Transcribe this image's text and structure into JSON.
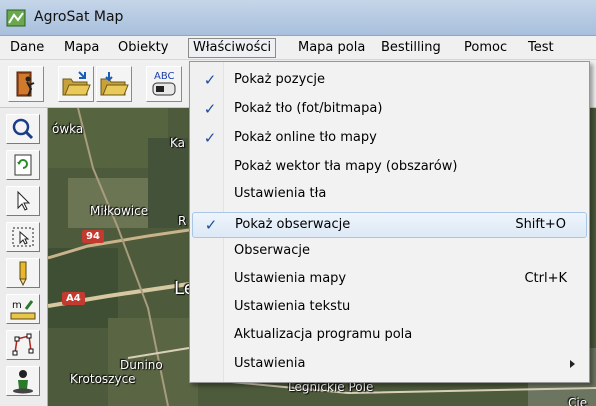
{
  "window": {
    "title": "AgroSat Map"
  },
  "menubar": {
    "items": [
      {
        "label": "Dane"
      },
      {
        "label": "Mapa"
      },
      {
        "label": "Obiekty"
      },
      {
        "label": "Właściwości"
      },
      {
        "label": "Mapa pola"
      },
      {
        "label": "Bestilling"
      },
      {
        "label": "Pomoc"
      },
      {
        "label": "Test"
      }
    ]
  },
  "toolbar": {
    "buttons": [
      {
        "icon": "exit-door-icon"
      },
      {
        "icon": "open-folder-icon"
      },
      {
        "icon": "save-folder-icon"
      },
      {
        "icon": "text-abc-icon",
        "label": "ABC"
      }
    ]
  },
  "side_toolbar": {
    "buttons": [
      {
        "icon": "zoom-icon"
      },
      {
        "icon": "refresh-icon"
      },
      {
        "icon": "pointer-icon"
      },
      {
        "icon": "select-area-icon"
      },
      {
        "icon": "pencil-icon"
      },
      {
        "icon": "measure-icon",
        "label": "m"
      },
      {
        "icon": "polygon-icon"
      },
      {
        "icon": "gps-person-icon"
      }
    ]
  },
  "map": {
    "labels": [
      "ówka",
      "Ka",
      "Miłkowice",
      "R",
      "Le",
      "Dunino",
      "Krotoszyce",
      "Legnickie Pole",
      "Cie"
    ],
    "road_shields": [
      "94",
      "A4"
    ]
  },
  "dropdown": {
    "items": [
      {
        "label": "Pokaż pozycje",
        "checked": true,
        "shortcut": "",
        "submenu": false,
        "highlighted": false
      },
      {
        "label": "Pokaż tło (fot/bitmapa)",
        "checked": true,
        "shortcut": "",
        "submenu": false,
        "highlighted": false
      },
      {
        "label": "Pokaż online tło mapy",
        "checked": true,
        "shortcut": "",
        "submenu": false,
        "highlighted": false
      },
      {
        "label": "Pokaż wektor tła mapy (obszarów)",
        "checked": false,
        "shortcut": "",
        "submenu": false,
        "highlighted": false
      },
      {
        "label": "Ustawienia tła",
        "checked": false,
        "shortcut": "",
        "submenu": false,
        "highlighted": false
      },
      {
        "label": "Pokaż obserwacje",
        "checked": true,
        "shortcut": "Shift+O",
        "submenu": false,
        "highlighted": true
      },
      {
        "label": "Obserwacje",
        "checked": false,
        "shortcut": "",
        "submenu": false,
        "highlighted": false
      },
      {
        "label": "Ustawienia mapy",
        "checked": false,
        "shortcut": "Ctrl+K",
        "submenu": false,
        "highlighted": false
      },
      {
        "label": "Ustawienia tekstu",
        "checked": false,
        "shortcut": "",
        "submenu": false,
        "highlighted": false
      },
      {
        "label": "Aktualizacja programu pola",
        "checked": false,
        "shortcut": "",
        "submenu": false,
        "highlighted": false
      },
      {
        "label": "Ustawienia",
        "checked": false,
        "shortcut": "",
        "submenu": true,
        "highlighted": false
      }
    ],
    "check_glyph": "✓"
  }
}
